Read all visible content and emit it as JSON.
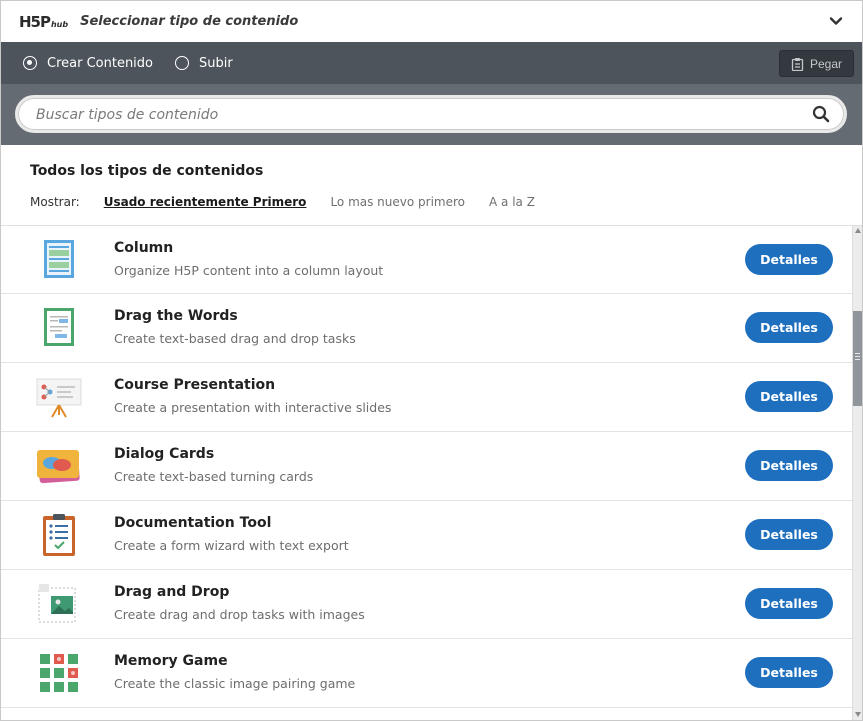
{
  "header": {
    "logo_main": "H5P",
    "logo_sub": "hub",
    "title": "Seleccionar tipo de contenido"
  },
  "tabs": {
    "create": "Crear Contenido",
    "upload": "Subir",
    "paste": "Pegar"
  },
  "search": {
    "placeholder": "Buscar tipos de contenido"
  },
  "filters": {
    "title": "Todos los tipos de contenidos",
    "show_label": "Mostrar:",
    "sort_recent": "Usado recientemente Primero",
    "sort_newest": "Lo mas nuevo primero",
    "sort_az": "A a la Z"
  },
  "items": [
    {
      "title": "Column",
      "desc": "Organize H5P content into a column layout",
      "button": "Detalles",
      "icon": "column-icon"
    },
    {
      "title": "Drag the Words",
      "desc": "Create text-based drag and drop tasks",
      "button": "Detalles",
      "icon": "drag-words-icon"
    },
    {
      "title": "Course Presentation",
      "desc": "Create a presentation with interactive slides",
      "button": "Detalles",
      "icon": "presentation-icon"
    },
    {
      "title": "Dialog Cards",
      "desc": "Create text-based turning cards",
      "button": "Detalles",
      "icon": "dialog-cards-icon"
    },
    {
      "title": "Documentation Tool",
      "desc": "Create a form wizard with text export",
      "button": "Detalles",
      "icon": "clipboard-icon"
    },
    {
      "title": "Drag and Drop",
      "desc": "Create drag and drop tasks with images",
      "button": "Detalles",
      "icon": "drag-drop-icon"
    },
    {
      "title": "Memory Game",
      "desc": "Create the classic image pairing game",
      "button": "Detalles",
      "icon": "memory-grid-icon"
    }
  ],
  "colors": {
    "tab_bar": "#4d545c",
    "search_bar": "#656b73",
    "button": "#1f6fbf"
  }
}
